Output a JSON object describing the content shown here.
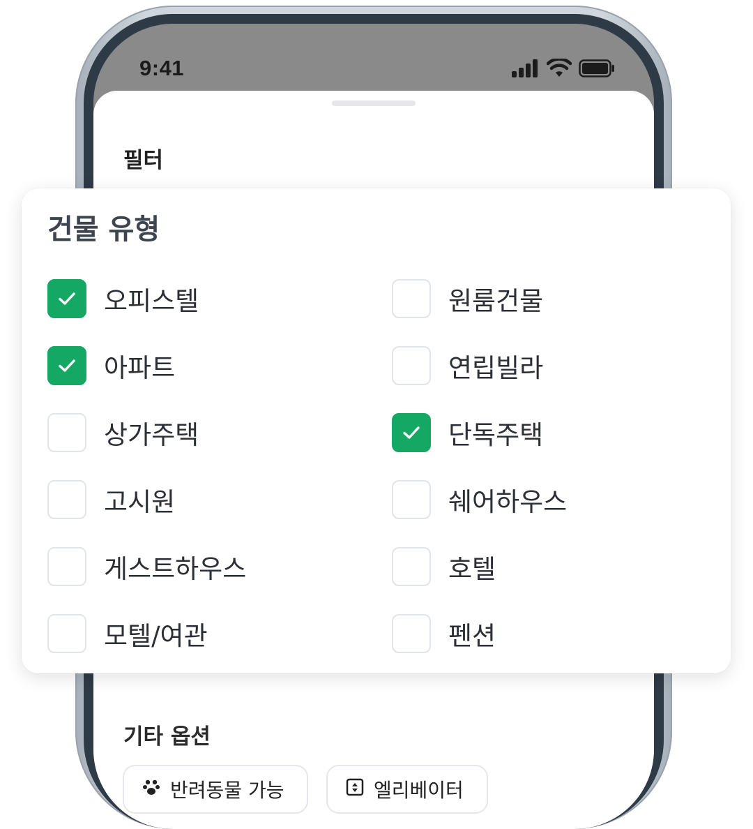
{
  "status_bar": {
    "time": "9:41",
    "icons": [
      "cellular-signal-icon",
      "wifi-icon",
      "battery-icon"
    ]
  },
  "sheet": {
    "title": "필터",
    "other_options_title": "기타 옵션",
    "option_chips": [
      {
        "label": "반려동물 가능",
        "icon": "paw-icon"
      },
      {
        "label": "엘리베이터",
        "icon": "elevator-icon"
      }
    ]
  },
  "filter_card": {
    "title": "건물 유형",
    "options": [
      {
        "label": "오피스텔",
        "checked": true
      },
      {
        "label": "원룸건물",
        "checked": false
      },
      {
        "label": "아파트",
        "checked": true
      },
      {
        "label": "연립빌라",
        "checked": false
      },
      {
        "label": "상가주택",
        "checked": false
      },
      {
        "label": "단독주택",
        "checked": true
      },
      {
        "label": "고시원",
        "checked": false
      },
      {
        "label": "쉐어하우스",
        "checked": false
      },
      {
        "label": "게스트하우스",
        "checked": false
      },
      {
        "label": "호텔",
        "checked": false
      },
      {
        "label": "모텔/여관",
        "checked": false
      },
      {
        "label": "펜션",
        "checked": false
      }
    ]
  },
  "colors": {
    "accent_green": "#14a864",
    "phone_bezel": "#2f3a47",
    "status_bar_bg": "#8a8a8a"
  }
}
